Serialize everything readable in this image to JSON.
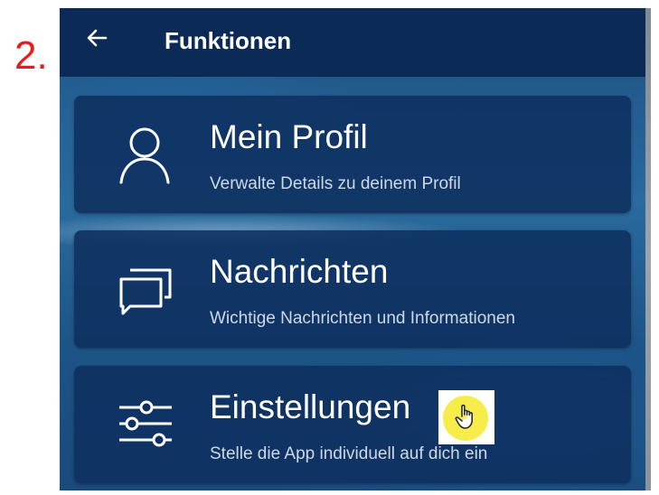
{
  "step_label": "2.",
  "app_bar": {
    "title": "Funktionen",
    "back_icon": "arrow-left-icon"
  },
  "menu_items": [
    {
      "icon": "person-icon",
      "title": "Mein Profil",
      "subtitle": "Verwalte Details zu deinem Profil"
    },
    {
      "icon": "chat-bubbles-icon",
      "title": "Nachrichten",
      "subtitle": "Wichtige Nachrichten und Informationen"
    },
    {
      "icon": "sliders-icon",
      "title": "Einstellungen",
      "subtitle": "Stelle die App individuell auf dich ein"
    }
  ],
  "cursor": {
    "icon": "hand-pointer-icon",
    "highlight_color": "#f6ec4a"
  },
  "colors": {
    "app_bar": "#0c2a56",
    "card": "#0e3060",
    "step_label": "#e81c1c"
  }
}
